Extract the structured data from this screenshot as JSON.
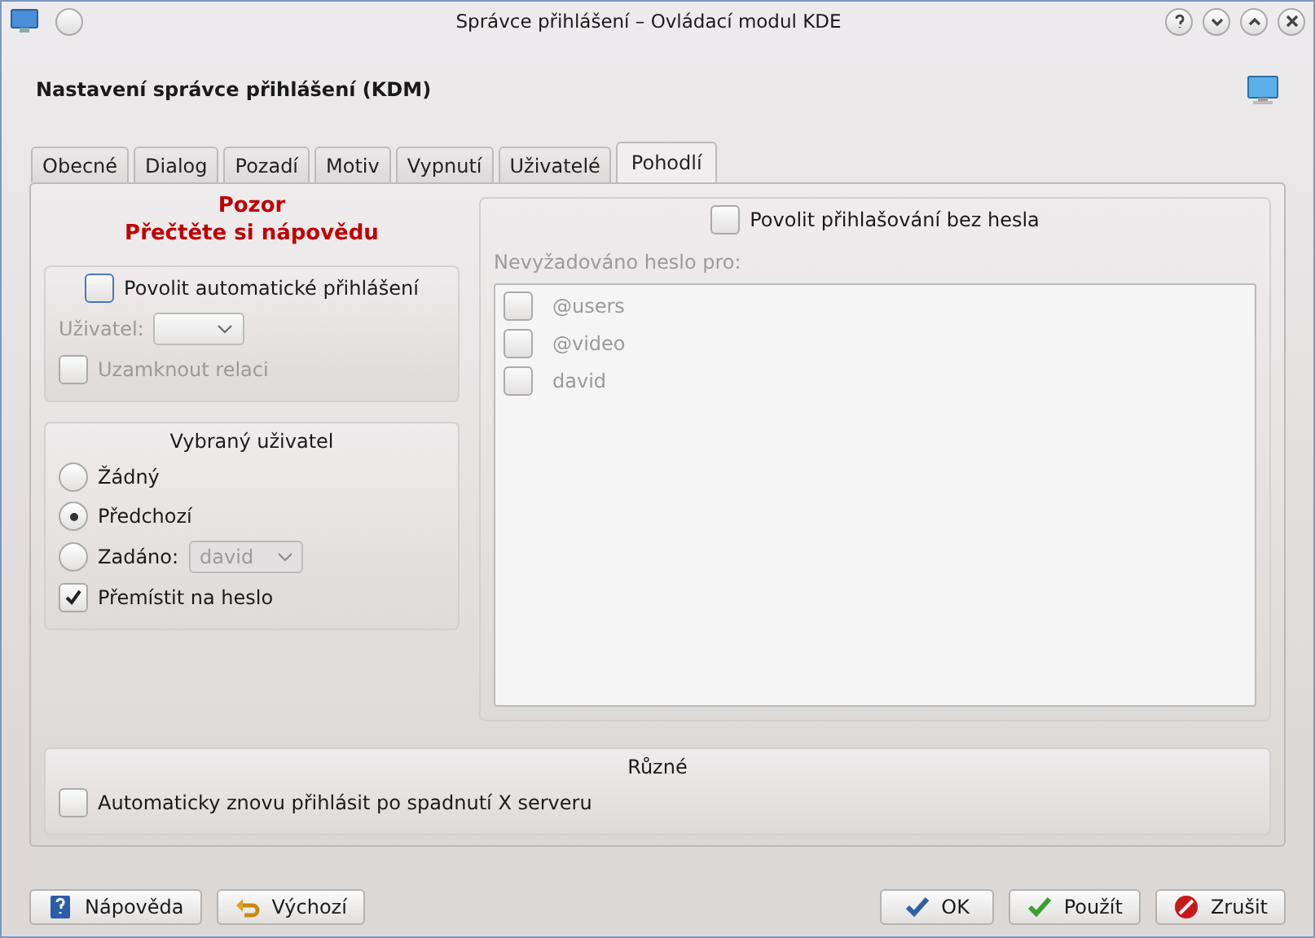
{
  "window": {
    "title": "Správce přihlášení – Ovládací modul KDE"
  },
  "header": {
    "title": "Nastavení správce přihlášení (KDM)"
  },
  "tabs": [
    {
      "label": "Obecné",
      "selected": false
    },
    {
      "label": "Dialog",
      "selected": false
    },
    {
      "label": "Pozadí",
      "selected": false
    },
    {
      "label": "Motiv",
      "selected": false
    },
    {
      "label": "Vypnutí",
      "selected": false
    },
    {
      "label": "Uživatelé",
      "selected": false
    },
    {
      "label": "Pohodlí",
      "selected": true
    }
  ],
  "warning": [
    "Pozor",
    "Přečtěte si nápovědu"
  ],
  "autologin": {
    "label": "Povolit automatické přihlášení",
    "checked": false,
    "user_label": "Uživatel:",
    "user_disabled": true,
    "lock": {
      "label": "Uzamknout relaci",
      "checked": false,
      "disabled": true
    }
  },
  "preselect": {
    "title": "Vybraný uživatel",
    "options": [
      {
        "label": "Žádný",
        "selected": false
      },
      {
        "label": "Předchozí",
        "selected": true
      },
      {
        "label": "Zadáno:",
        "selected": false
      }
    ],
    "specified_value": "david",
    "focus_password": {
      "label": "Přemístit na heslo",
      "checked": true
    }
  },
  "nopassword": {
    "label": "Povolit přihlašování bez hesla",
    "checked": false,
    "list_label": "Nevyžadováno heslo pro:",
    "users": [
      {
        "label": "@users",
        "checked": false,
        "disabled": true
      },
      {
        "label": "@video",
        "checked": false,
        "disabled": true
      },
      {
        "label": "david",
        "checked": false,
        "disabled": true
      }
    ]
  },
  "misc": {
    "title": "Různé",
    "relogin": {
      "label": "Automaticky znovu přihlásit po spadnutí X serveru",
      "checked": false
    }
  },
  "buttons": [
    {
      "label": "Nápověda",
      "kind": "help"
    },
    {
      "label": "Výchozí",
      "kind": "defaults"
    },
    {
      "label": "OK",
      "kind": "ok"
    },
    {
      "label": "Použít",
      "kind": "apply"
    },
    {
      "label": "Zrušit",
      "kind": "cancel"
    }
  ]
}
